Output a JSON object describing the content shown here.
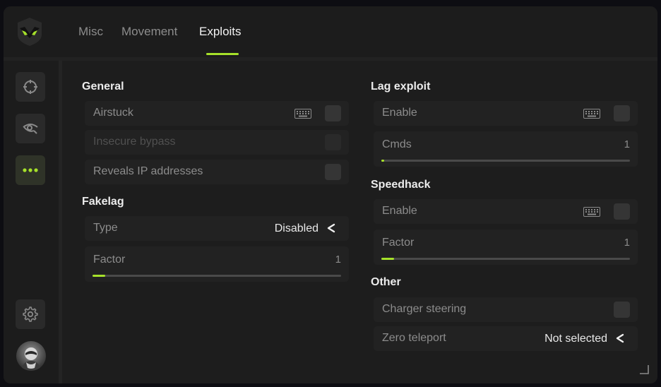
{
  "header": {
    "tabs": [
      {
        "label": "Misc"
      },
      {
        "label": "Movement"
      },
      {
        "label": "Exploits"
      }
    ],
    "active_tab": "Exploits",
    "accent_color": "#a6e12a"
  },
  "sidebar": {
    "items": [
      {
        "icon": "crosshair-icon"
      },
      {
        "icon": "eye-icon"
      },
      {
        "icon": "more-dots-icon",
        "active": true
      },
      {
        "icon": "gear-icon"
      }
    ],
    "avatar_icon": "user-avatar"
  },
  "general": {
    "title": "General",
    "airstuck_label": "Airstuck",
    "insecure_bypass_label": "Insecure bypass",
    "reveals_ip_label": "Reveals IP addresses"
  },
  "fakelag": {
    "title": "Fakelag",
    "type_label": "Type",
    "type_value": "Disabled",
    "factor_label": "Factor",
    "factor_value": "1",
    "factor_fill": 0.05
  },
  "lag_exploit": {
    "title": "Lag exploit",
    "enable_label": "Enable",
    "cmds_label": "Cmds",
    "cmds_value": "1",
    "cmds_fill": 0.01
  },
  "speedhack": {
    "title": "Speedhack",
    "enable_label": "Enable",
    "factor_label": "Factor",
    "factor_value": "1",
    "factor_fill": 0.05
  },
  "other": {
    "title": "Other",
    "charger_steering_label": "Charger steering",
    "zero_teleport_label": "Zero teleport",
    "zero_teleport_value": "Not selected"
  }
}
